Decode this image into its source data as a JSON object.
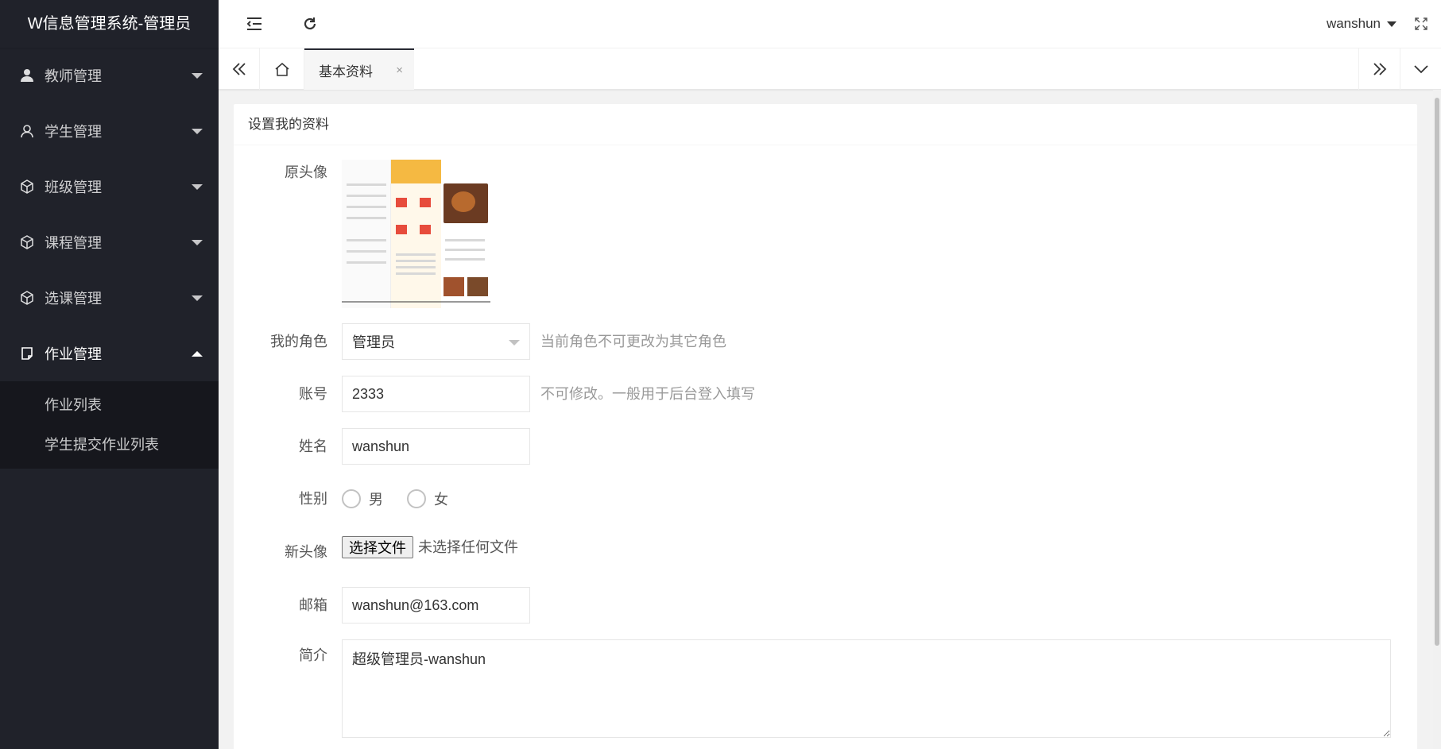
{
  "app": {
    "title": "W信息管理系统-管理员"
  },
  "sidebar": {
    "items": [
      {
        "label": "教师管理",
        "icon": "user-solid-icon",
        "expanded": false
      },
      {
        "label": "学生管理",
        "icon": "user-outline-icon",
        "expanded": false
      },
      {
        "label": "班级管理",
        "icon": "cube-icon",
        "expanded": false
      },
      {
        "label": "课程管理",
        "icon": "cube-icon",
        "expanded": false
      },
      {
        "label": "选课管理",
        "icon": "cube-icon",
        "expanded": false
      },
      {
        "label": "作业管理",
        "icon": "note-icon",
        "expanded": true
      }
    ],
    "submenu": [
      {
        "label": "作业列表"
      },
      {
        "label": "学生提交作业列表"
      }
    ]
  },
  "header": {
    "user": "wanshun"
  },
  "tabs": {
    "active_label": "基本资料",
    "close": "×"
  },
  "form": {
    "title": "设置我的资料",
    "avatar_label": "原头像",
    "role_label": "我的角色",
    "role_value": "管理员",
    "role_hint": "当前角色不可更改为其它角色",
    "account_label": "账号",
    "account_value": "2333",
    "account_hint": "不可修改。一般用于后台登入填写",
    "name_label": "姓名",
    "name_value": "wanshun",
    "gender_label": "性别",
    "gender_male": "男",
    "gender_female": "女",
    "new_avatar_label": "新头像",
    "file_button": "选择文件",
    "file_status": "未选择任何文件",
    "email_label": "邮箱",
    "email_value": "wanshun@163.com",
    "bio_label": "简介",
    "bio_value": "超级管理员-wanshun"
  },
  "colors": {
    "sidebar_bg": "#20222a",
    "accent": "#292b34",
    "avatar_orange": "#f5b942"
  }
}
